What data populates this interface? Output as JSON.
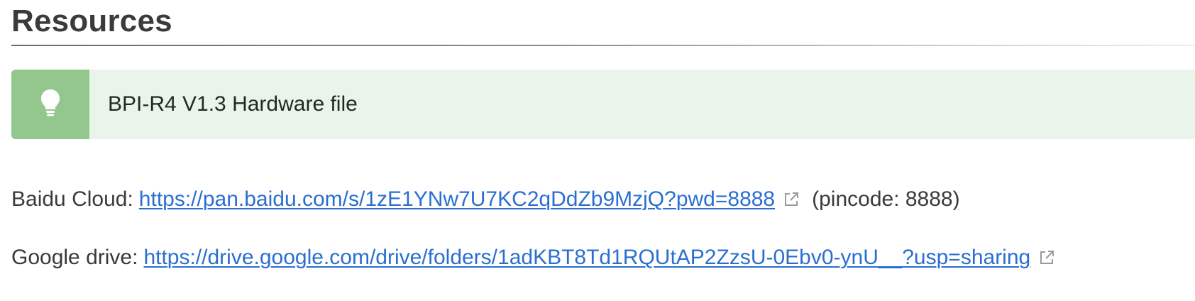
{
  "section": {
    "title": "Resources"
  },
  "tip": {
    "icon": "lightbulb-icon",
    "text": "BPI-R4 V1.3 Hardware file",
    "colors": {
      "background": "#e9f5ea",
      "icon_panel": "#93c78e"
    }
  },
  "links": {
    "baidu": {
      "label": "Baidu Cloud:",
      "url": "https://pan.baidu.com/s/1zE1YNw7U7KC2qDdZb9MzjQ?pwd=8888",
      "icon": "external-link-icon",
      "note": "(pincode: 8888)"
    },
    "google": {
      "label": "Google drive:",
      "url": "https://drive.google.com/drive/folders/1adKBT8Td1RQUtAP2ZzsU-0Ebv0-ynU__?usp=sharing",
      "icon": "external-link-icon"
    },
    "link_color": "#2a6fd0"
  }
}
